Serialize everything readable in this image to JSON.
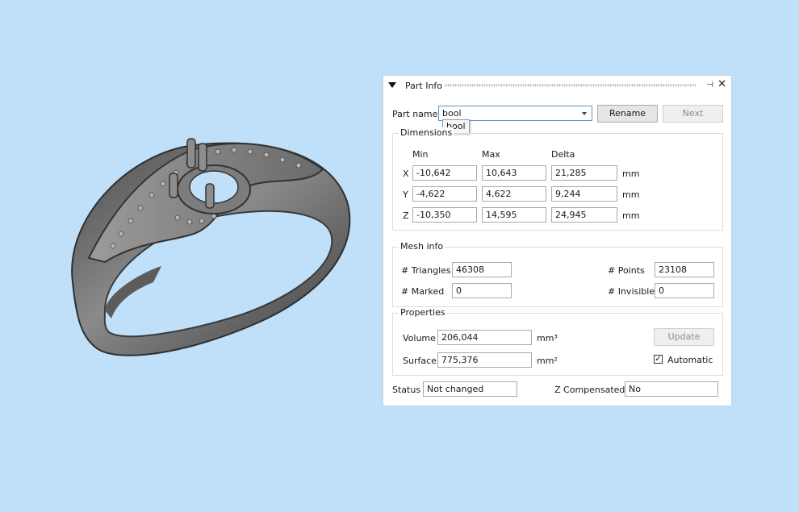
{
  "panel": {
    "title": "Part Info",
    "part_name_label": "Part name",
    "part_name_value": "bool",
    "tooltip_text": "bool",
    "rename_label": "Rename",
    "next_label": "Next"
  },
  "dimensions": {
    "title": "Dimensions",
    "headers": {
      "min": "Min",
      "max": "Max",
      "delta": "Delta"
    },
    "rows": [
      {
        "axis": "X",
        "min": "-10,642",
        "max": "10,643",
        "delta": "21,285",
        "unit": "mm"
      },
      {
        "axis": "Y",
        "min": "-4,622",
        "max": "4,622",
        "delta": "9,244",
        "unit": "mm"
      },
      {
        "axis": "Z",
        "min": "-10,350",
        "max": "14,595",
        "delta": "24,945",
        "unit": "mm"
      }
    ]
  },
  "mesh": {
    "title": "Mesh info",
    "triangles_label": "# Triangles",
    "triangles_value": "46308",
    "points_label": "# Points",
    "points_value": "23108",
    "marked_label": "# Marked",
    "marked_value": "0",
    "invisible_label": "# Invisible",
    "invisible_value": "0"
  },
  "properties": {
    "title": "Properties",
    "volume_label": "Volume",
    "volume_value": "206,044",
    "volume_unit": "mm³",
    "surface_label": "Surface",
    "surface_value": "775,376",
    "surface_unit": "mm²",
    "update_label": "Update",
    "automatic_label": "Automatic",
    "automatic_checked": true
  },
  "status": {
    "status_label": "Status",
    "status_value": "Not changed",
    "zcomp_label": "Z Compensated",
    "zcomp_value": "No"
  },
  "colors": {
    "background": "#bfe0f8",
    "ring_metal": "#6b6b6b"
  }
}
